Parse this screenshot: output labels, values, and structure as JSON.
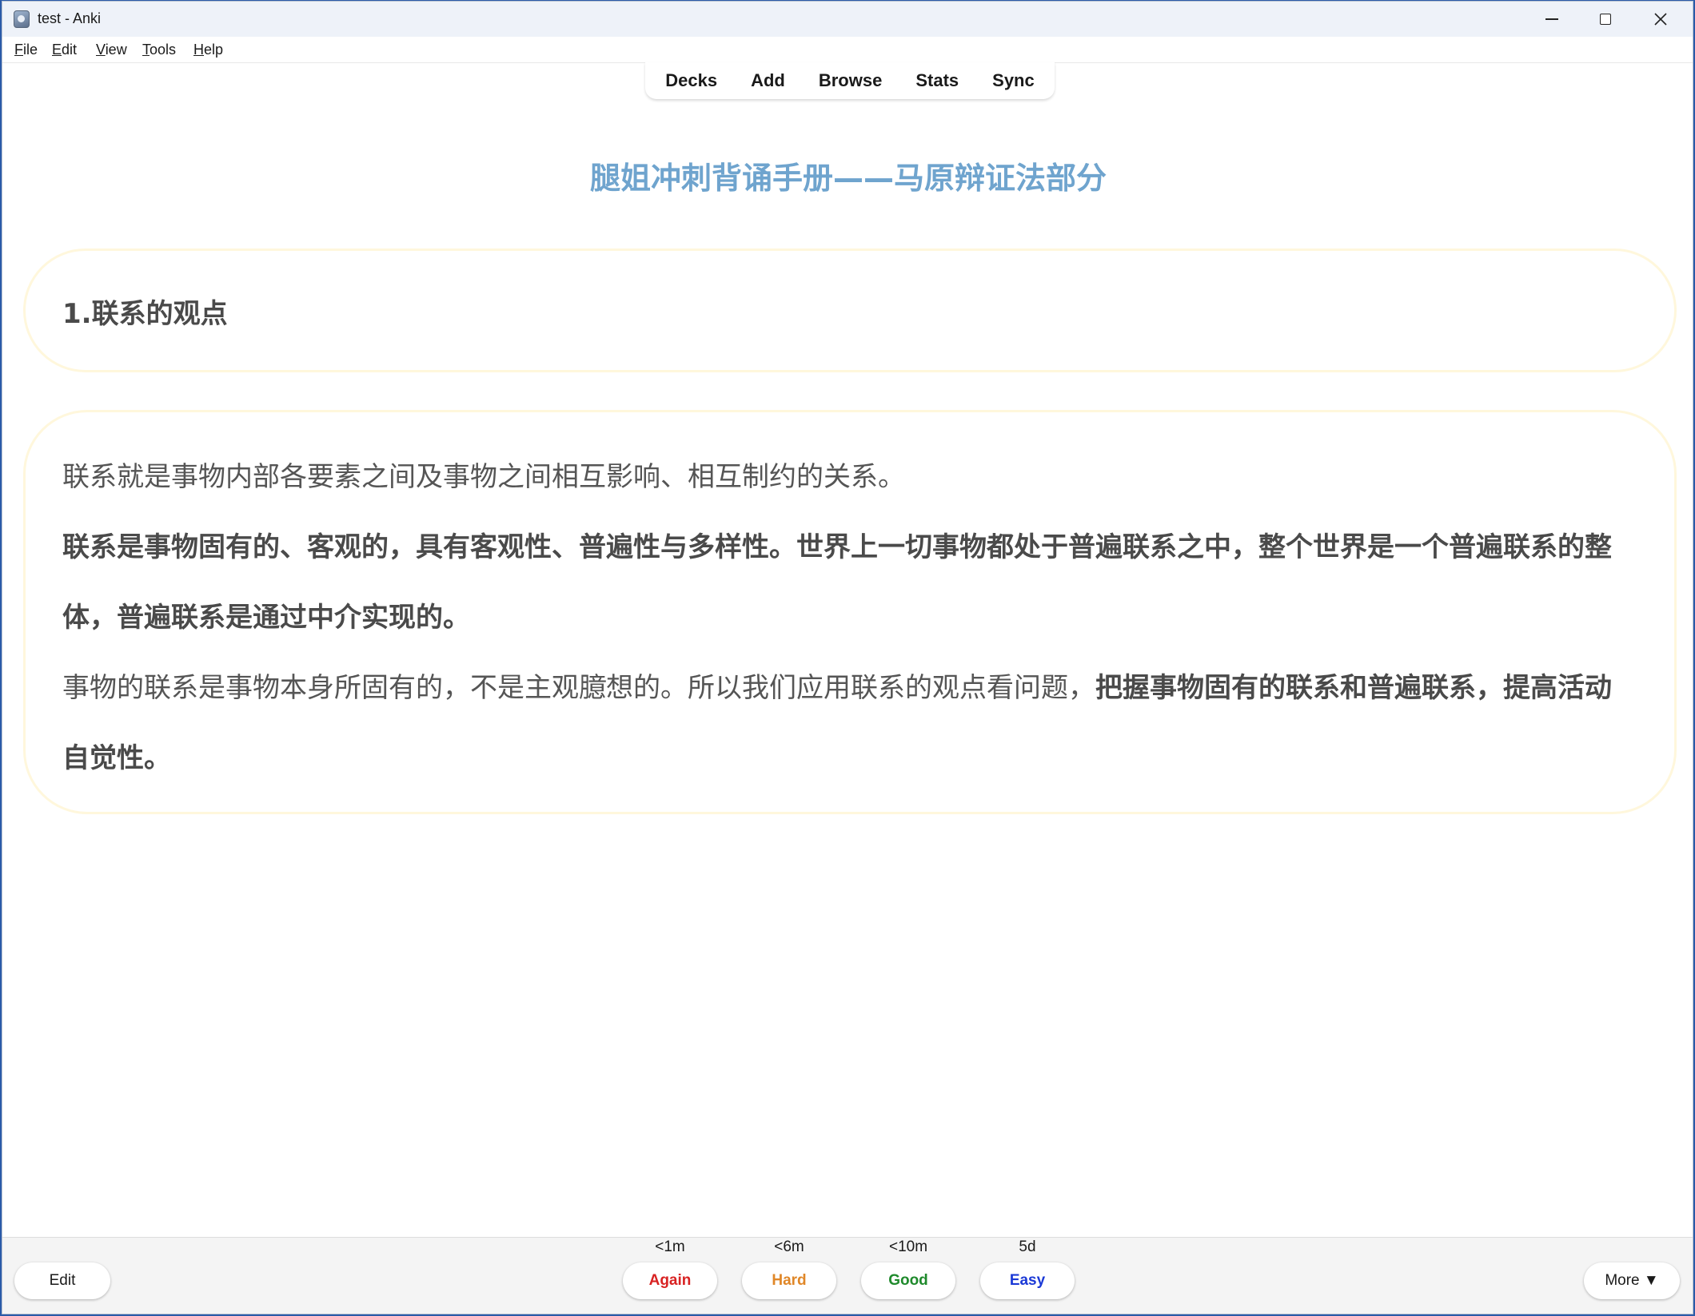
{
  "window": {
    "title": "test - Anki"
  },
  "menu": {
    "items": [
      {
        "mnemonic": "F",
        "rest": "ile"
      },
      {
        "mnemonic": "E",
        "rest": "dit"
      },
      {
        "mnemonic": "V",
        "rest": "iew"
      },
      {
        "mnemonic": "T",
        "rest": "ools"
      },
      {
        "mnemonic": "H",
        "rest": "elp"
      }
    ]
  },
  "toolbar": {
    "decks": "Decks",
    "add": "Add",
    "browse": "Browse",
    "stats": "Stats",
    "sync": "Sync"
  },
  "card": {
    "title": "腿姐冲刺背诵手册——马原辩证法部分",
    "heading": "1.联系的观点",
    "para1": "联系就是事物内部各要素之间及事物之间相互影响、相互制约的关系。",
    "para2_bold": "联系是事物固有的、客观的，具有客观性、普遍性与多样性。世界上一切事物都处于普遍联系之中，整个世界是一个普遍联系的整体，普遍联系是通过中介实现的。",
    "para3_normal": "事物的联系是事物本身所固有的，不是主观臆想的。所以我们应用联系的观点看问题，",
    "para3_bold": "把握事物固有的联系和普遍联系，提高活动自觉性。"
  },
  "bottom": {
    "edit": "Edit",
    "more": "More ▼",
    "answers": {
      "again": {
        "label": "Again",
        "interval": "<1m",
        "color": "#d82222"
      },
      "hard": {
        "label": "Hard",
        "interval": "<6m",
        "color": "#e08728"
      },
      "good": {
        "label": "Good",
        "interval": "<10m",
        "color": "#1f8a2c"
      },
      "easy": {
        "label": "Easy",
        "interval": "5d",
        "color": "#1b39d6"
      }
    }
  },
  "colors": {
    "title_accent": "#6fa4ce",
    "box_border": "#fff7dc",
    "desktop": "#2a5aa8"
  }
}
